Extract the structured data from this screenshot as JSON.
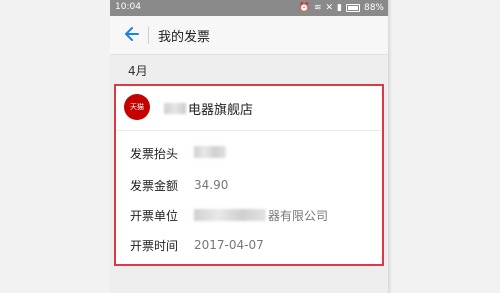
{
  "status_bar": {
    "time": "10:04",
    "battery": "88%"
  },
  "nav": {
    "title": "我的发票"
  },
  "section": {
    "month": "4月"
  },
  "invoice": {
    "shop_logo_text": "天猫",
    "shop_name": "电器旗舰店",
    "fields": [
      {
        "label": "发票抬头",
        "value": ""
      },
      {
        "label": "发票金额",
        "value": "34.90"
      },
      {
        "label": "开票单位",
        "value": "器有限公司"
      },
      {
        "label": "开票时间",
        "value": "2017-04-07"
      }
    ]
  },
  "colors": {
    "highlight_border": "#d93a44",
    "back_arrow": "#1a82e0",
    "status_bar": "#8a8a8a"
  }
}
